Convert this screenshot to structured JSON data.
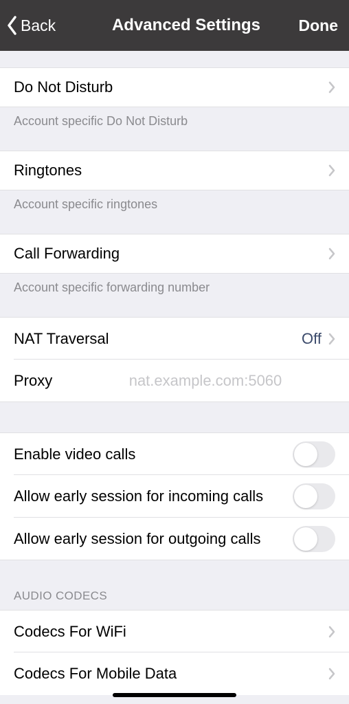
{
  "nav": {
    "back_label": "Back",
    "title": "Advanced Settings",
    "done": "Done"
  },
  "dnd": {
    "label": "Do Not Disturb",
    "footer": "Account specific Do Not Disturb"
  },
  "ringtones": {
    "label": "Ringtones",
    "footer": "Account specific ringtones"
  },
  "forwarding": {
    "label": "Call Forwarding",
    "footer": "Account specific forwarding number"
  },
  "nat": {
    "label": "NAT Traversal",
    "value": "Off"
  },
  "proxy": {
    "label": "Proxy",
    "placeholder": "nat.example.com:5060",
    "value": ""
  },
  "video": {
    "enable_label": "Enable video calls",
    "early_incoming_label": "Allow early session for incoming calls",
    "early_outgoing_label": "Allow early session for outgoing calls"
  },
  "codecs": {
    "header": "AUDIO CODECS",
    "wifi_label": "Codecs For WiFi",
    "mobile_label": "Codecs For Mobile Data"
  }
}
